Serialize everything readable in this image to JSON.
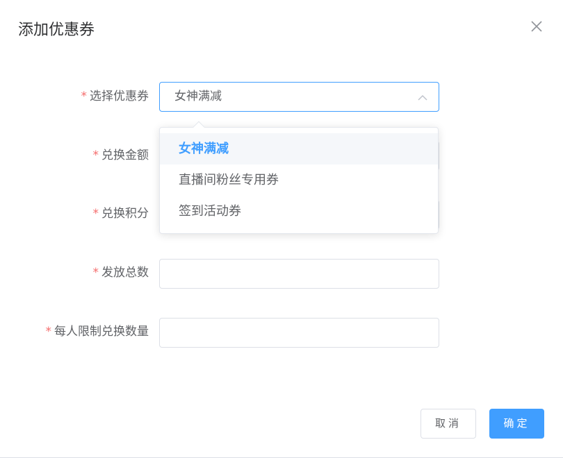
{
  "dialog": {
    "title": "添加优惠券",
    "close_icon": "close-icon"
  },
  "form": {
    "required_mark": "*",
    "coupon": {
      "label": "选择优惠券",
      "value": "女神满减"
    },
    "amount": {
      "label": "兑换金额",
      "value": ""
    },
    "points": {
      "label": "兑换积分",
      "value": ""
    },
    "total": {
      "label": "发放总数",
      "value": ""
    },
    "limit": {
      "label": "每人限制兑换数量",
      "value": ""
    }
  },
  "dropdown": {
    "options": [
      {
        "label": "女神满减",
        "selected": true
      },
      {
        "label": "直播间粉丝专用券",
        "selected": false
      },
      {
        "label": "签到活动券",
        "selected": false
      }
    ]
  },
  "footer": {
    "cancel_label": "取消",
    "confirm_label": "确定"
  },
  "colors": {
    "primary": "#409eff",
    "required": "#f56c6c",
    "text": "#606266"
  }
}
